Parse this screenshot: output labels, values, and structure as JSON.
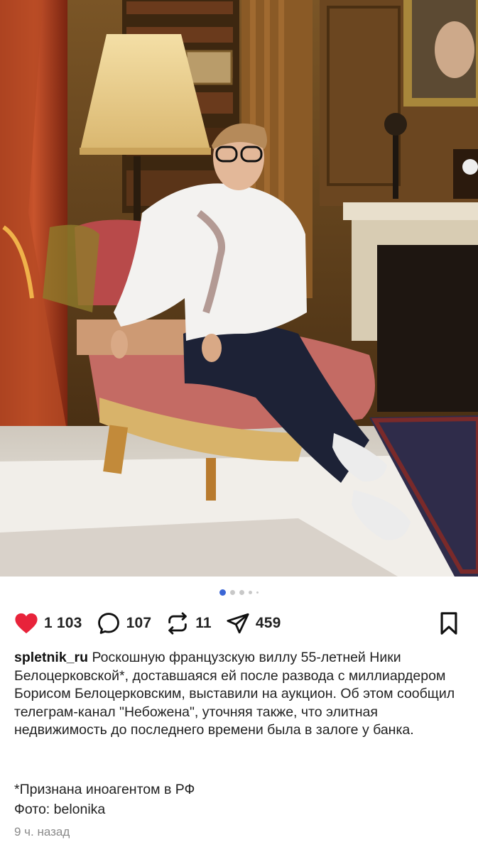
{
  "post": {
    "likes": "1 103",
    "comments": "107",
    "reposts": "11",
    "shares": "459",
    "username": "spletnik_ru",
    "caption": "Роскошную французскую виллу 55-летней Ники Белоцерковской*, доставшаяся ей после развода с миллиардером Борисом Белоцерковским, выставили на аукцион. Об этом сообщил телеграм-канал \"Небожена\", уточняя также, что элитная недвижимость до последнего времени была в залоге у банка.",
    "note_line1": "*Признана иноагентом в РФ",
    "note_line2": "Фото: belonika",
    "time": "9 ч. назад"
  },
  "carousel": {
    "current": 1,
    "count": 5
  },
  "colors": {
    "like": "#e8233a",
    "dot_active": "#3b66d6",
    "dot": "#c8c8c8"
  },
  "icons": [
    "heart-icon",
    "comment-icon",
    "repost-icon",
    "share-icon",
    "bookmark-icon"
  ]
}
